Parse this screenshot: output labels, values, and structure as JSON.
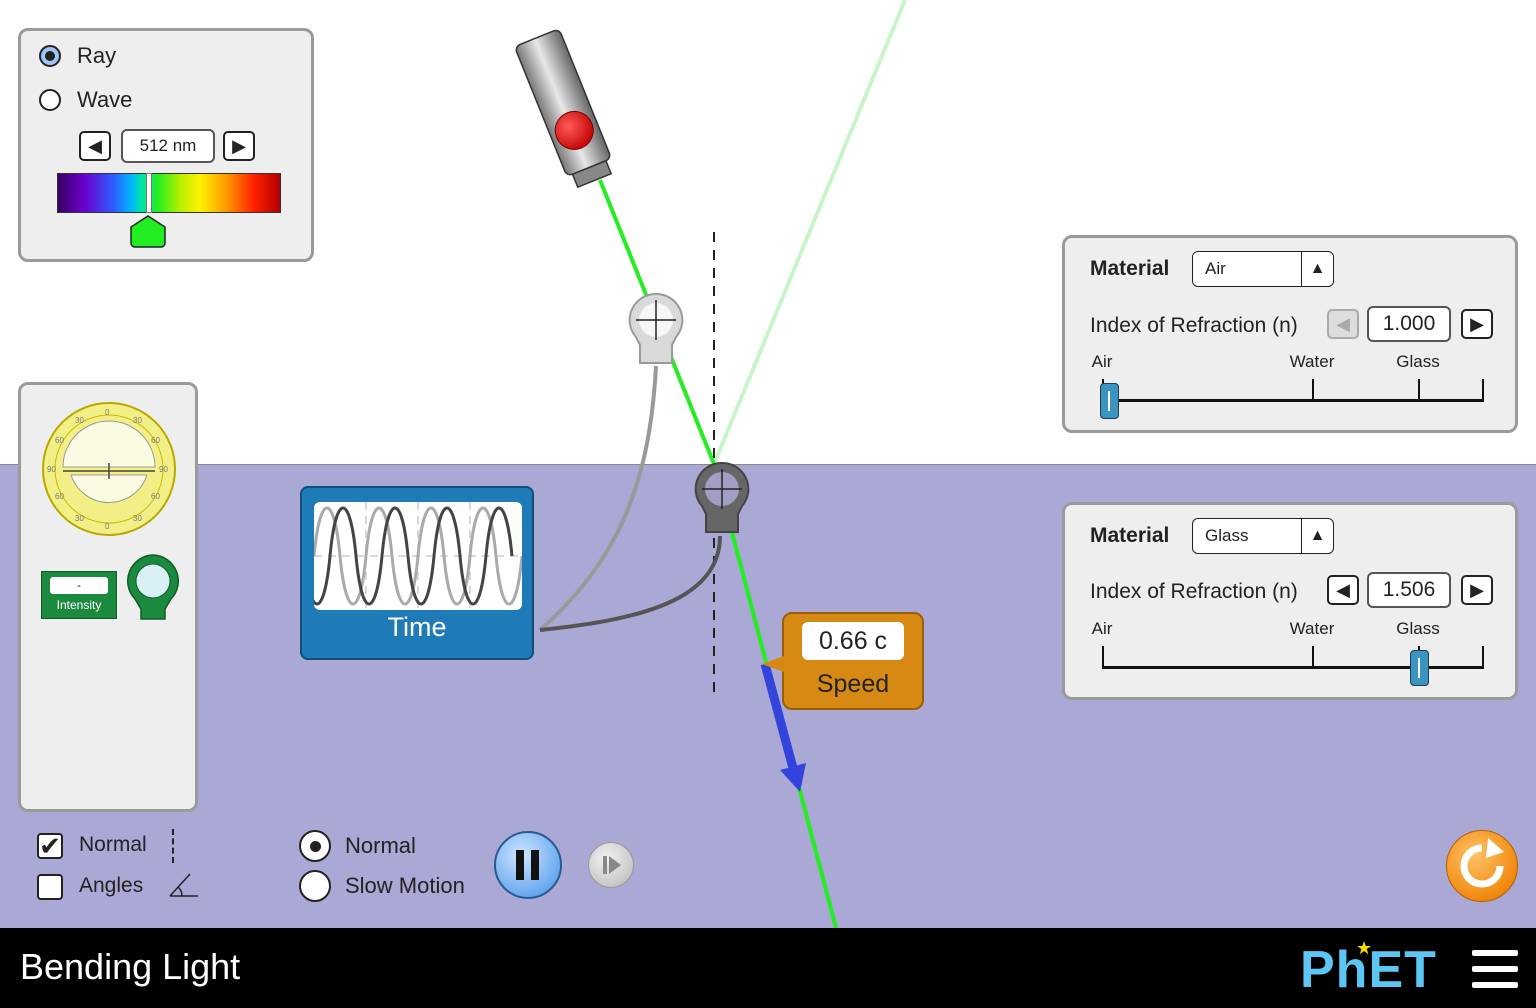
{
  "title": "Bending Light",
  "brand": "PhET",
  "light_panel": {
    "mode_options": [
      "Ray",
      "Wave"
    ],
    "selected_mode": "Ray",
    "wavelength": "512 nm"
  },
  "top_medium": {
    "material_label": "Material",
    "material_value": "Air",
    "ior_label": "Index of Refraction (n)",
    "ior_value": "1.000",
    "slider_fraction": 0.0,
    "ticks": [
      "Air",
      "Water",
      "Glass"
    ]
  },
  "bottom_medium": {
    "material_label": "Material",
    "material_value": "Glass",
    "ior_label": "Index of Refraction (n)",
    "ior_value": "1.506",
    "slider_fraction": 0.83,
    "ticks": [
      "Air",
      "Water",
      "Glass"
    ]
  },
  "toolbox": {
    "intensity_value": "-",
    "intensity_label": "Intensity"
  },
  "time_sensor": {
    "label": "Time"
  },
  "speed_sensor": {
    "value": "0.66 c",
    "label": "Speed"
  },
  "checkboxes": [
    {
      "label": "Normal",
      "checked": true
    },
    {
      "label": "Angles",
      "checked": false
    }
  ],
  "speed_options": [
    "Normal",
    "Slow Motion"
  ],
  "selected_speed": "Normal",
  "colors": {
    "laser": "#22ee22",
    "reflected": "#c8f5c8",
    "bottom_medium": "#aaa8d4",
    "sensor_blue": "#1e7bb7",
    "speed_box": "#d68a14"
  }
}
